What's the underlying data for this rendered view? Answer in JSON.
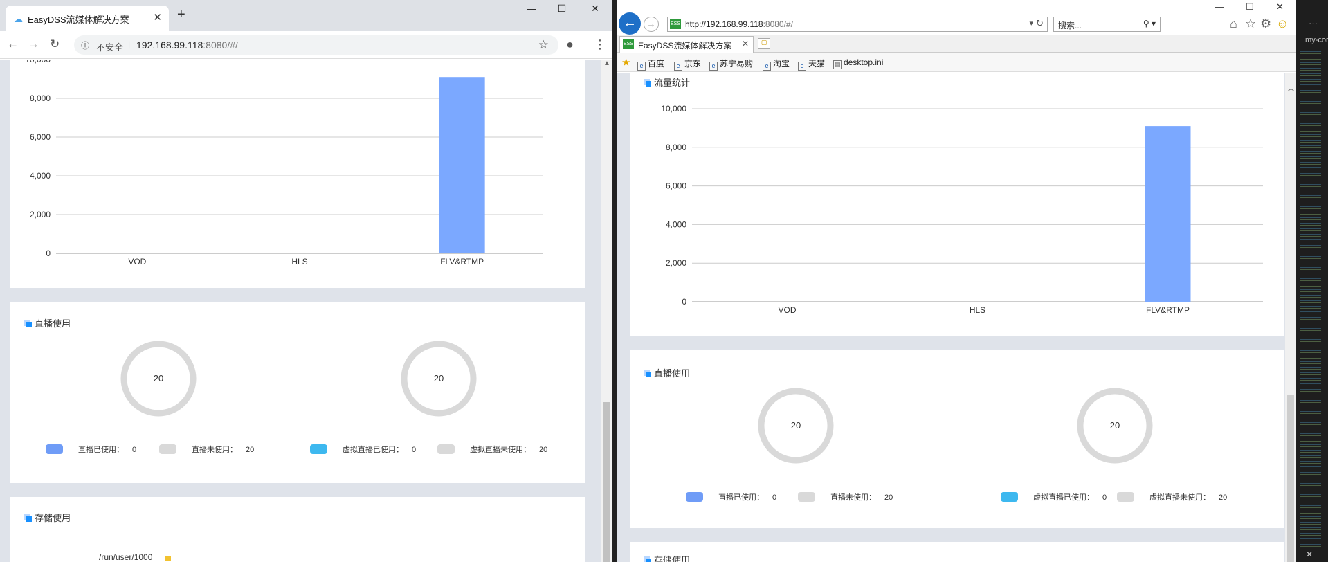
{
  "chrome": {
    "tab_title": "EasyDSS流媒体解决方案",
    "insecure_label": "不安全",
    "url_host": "192.168.99.118",
    "url_rest": ":8080/#/",
    "icons": [
      "cloud-favicon",
      "close-icon",
      "plus-icon",
      "minimize-icon",
      "maximize-icon",
      "close-window-icon",
      "back-icon",
      "forward-icon",
      "reload-icon",
      "info-icon",
      "star-icon",
      "account-icon",
      "menu-icon"
    ]
  },
  "ie": {
    "url_prefix": "http://",
    "url_host": "192.168.99.118",
    "url_rest": ":8080/#/",
    "search_placeholder": "搜索...",
    "tab_title": "EasyDSS流媒体解决方案",
    "favorites": [
      "百度",
      "京东",
      "苏宁易购",
      "淘宝",
      "天猫",
      "desktop.ini"
    ]
  },
  "editor": {
    "label": ".my-cor"
  },
  "left": {
    "traffic": {
      "title": "流量统计"
    },
    "live": {
      "title": "直播使用",
      "ring1_value": "20",
      "ring2_value": "20",
      "legend": [
        {
          "label": "直播已使用：",
          "value": "0",
          "color": "#6f9cf7"
        },
        {
          "label": "直播未使用：",
          "value": "20",
          "color": "#d9d9d9"
        },
        {
          "label": "虚拟直播已使用：",
          "value": "0",
          "color": "#3db8ef"
        },
        {
          "label": "虚拟直播未使用：",
          "value": "20",
          "color": "#d9d9d9"
        }
      ]
    },
    "storage": {
      "title": "存储使用",
      "path_label": "/run/user/1000"
    }
  },
  "right": {
    "traffic": {
      "title": "流量统计"
    },
    "live": {
      "title": "直播使用",
      "ring1_value": "20",
      "ring2_value": "20",
      "legend": [
        {
          "label": "直播已使用：",
          "value": "0",
          "color": "#6f9cf7"
        },
        {
          "label": "直播未使用：",
          "value": "20",
          "color": "#d9d9d9"
        },
        {
          "label": "虚拟直播已使用：",
          "value": "0",
          "color": "#3db8ef"
        },
        {
          "label": "虚拟直播未使用：",
          "value": "20",
          "color": "#d9d9d9"
        }
      ]
    },
    "storage": {
      "title": "存储使用"
    }
  },
  "chart_data": [
    {
      "type": "bar",
      "categories": [
        "VOD",
        "HLS",
        "FLV&RTMP"
      ],
      "values": [
        0,
        0,
        9100
      ],
      "ylim": [
        0,
        10000
      ],
      "yticks": [
        "0",
        "2,000",
        "4,000",
        "6,000",
        "8,000",
        "10,000"
      ],
      "grid": true,
      "color": "#7ba8ff"
    },
    {
      "type": "bar",
      "title": "流量统计",
      "categories": [
        "VOD",
        "HLS",
        "FLV&RTMP"
      ],
      "values": [
        0,
        0,
        9100
      ],
      "ylim": [
        0,
        10000
      ],
      "yticks": [
        "0",
        "2,000",
        "4,000",
        "6,000",
        "8,000",
        "10,000"
      ],
      "grid": true,
      "color": "#7ba8ff"
    }
  ]
}
